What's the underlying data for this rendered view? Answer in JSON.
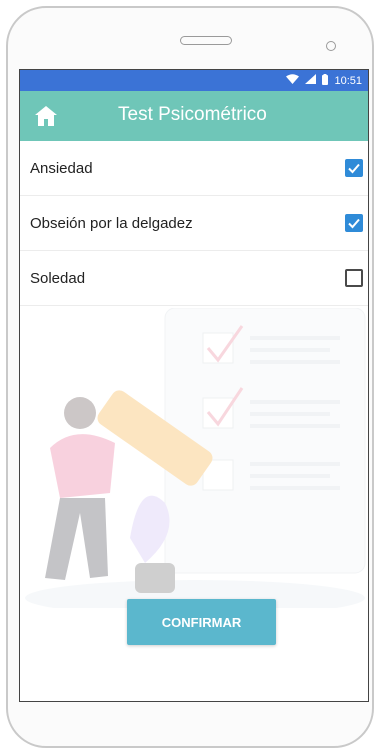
{
  "status": {
    "time": "10:51"
  },
  "appbar": {
    "title": "Test Psicométrico",
    "home_icon": "home-icon"
  },
  "options": [
    {
      "label": "Ansiedad",
      "checked": true
    },
    {
      "label": "Obseión por la delgadez",
      "checked": true
    },
    {
      "label": "Soledad",
      "checked": false
    }
  ],
  "confirm_label": "CONFIRMAR",
  "colors": {
    "status_bar": "#3b73d6",
    "app_bar": "#6fc6b8",
    "checkbox": "#2f8bd8",
    "button": "#5bb7cd"
  }
}
